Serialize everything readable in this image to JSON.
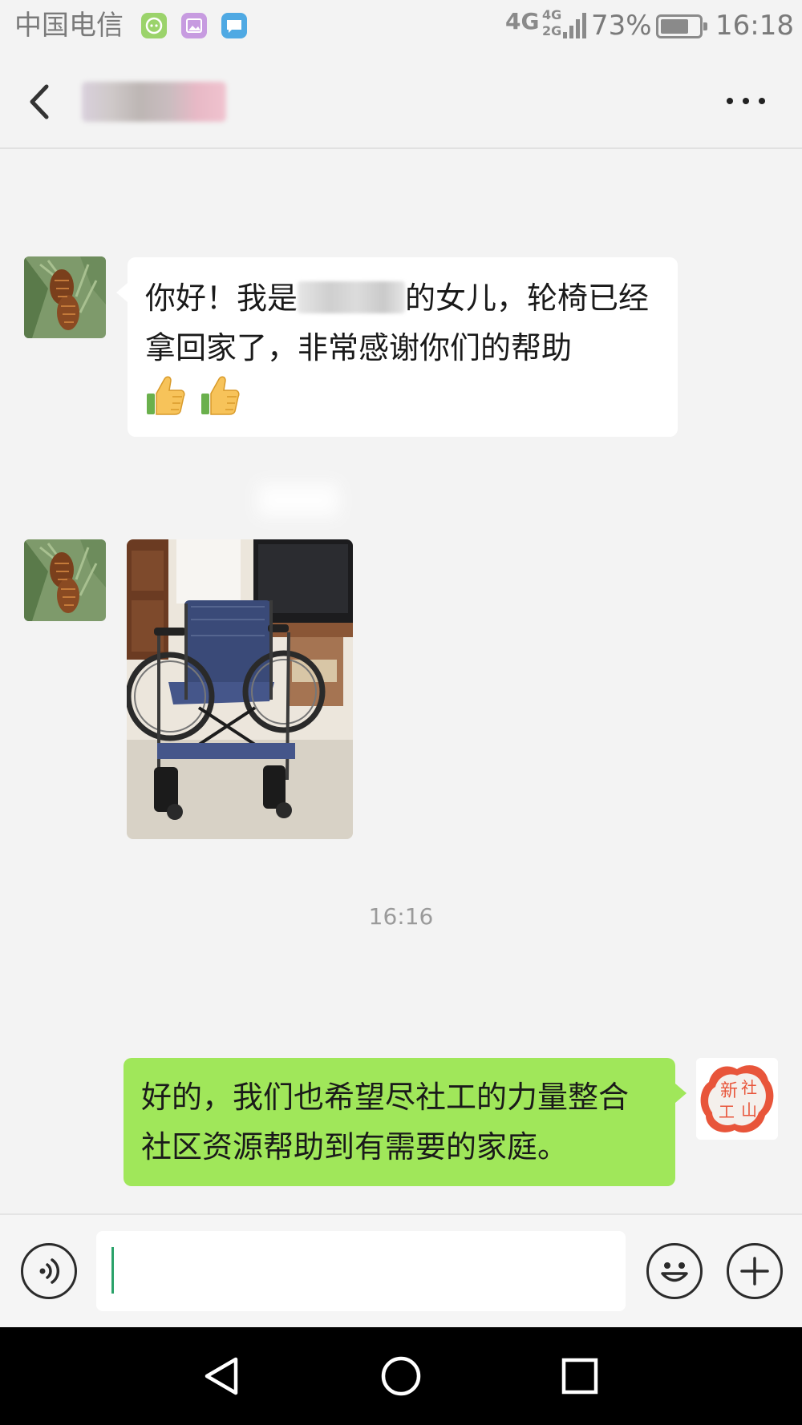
{
  "status_bar": {
    "carrier": "中国电信",
    "network": "4G",
    "network_small_top": "4G",
    "network_small_bottom": "2G",
    "battery_percent": "73%",
    "battery_level": 0.73,
    "time": "16:18",
    "notification_icons": [
      "wechat-app-icon",
      "gallery-app-icon",
      "message-app-icon"
    ]
  },
  "header": {
    "back_icon": "chevron-left-icon",
    "more_icon": "more-dots-icon"
  },
  "messages": [
    {
      "sender": "contact",
      "type": "text",
      "text_before": "你好！我是",
      "text_after": "的女儿，轮椅已经拿回家了，非常感谢你们的帮助",
      "emoji": [
        "thumbs-up-icon",
        "thumbs-up-icon"
      ]
    },
    {
      "sender": "contact",
      "type": "image",
      "image_subject": "wheelchair-photo"
    },
    {
      "type": "timestamp",
      "text": "16:16"
    },
    {
      "sender": "me",
      "type": "text",
      "text": "好的，我们也希望尽社工的力量整合社区资源帮助到有需要的家庭。",
      "avatar_text": [
        "新",
        "社",
        "工",
        "山"
      ]
    }
  ],
  "input_bar": {
    "voice_icon": "voice-input-icon",
    "input_value": "",
    "emoji_icon": "smiley-icon",
    "plus_icon": "plus-circle-icon"
  },
  "system_nav": [
    "back-triangle-icon",
    "home-circle-icon",
    "recents-square-icon"
  ],
  "colors": {
    "background": "#f3f3f3",
    "incoming_bubble": "#ffffff",
    "outgoing_bubble": "#a0e75a",
    "status_text": "#7a7a7a",
    "nav_bar": "#000000"
  }
}
